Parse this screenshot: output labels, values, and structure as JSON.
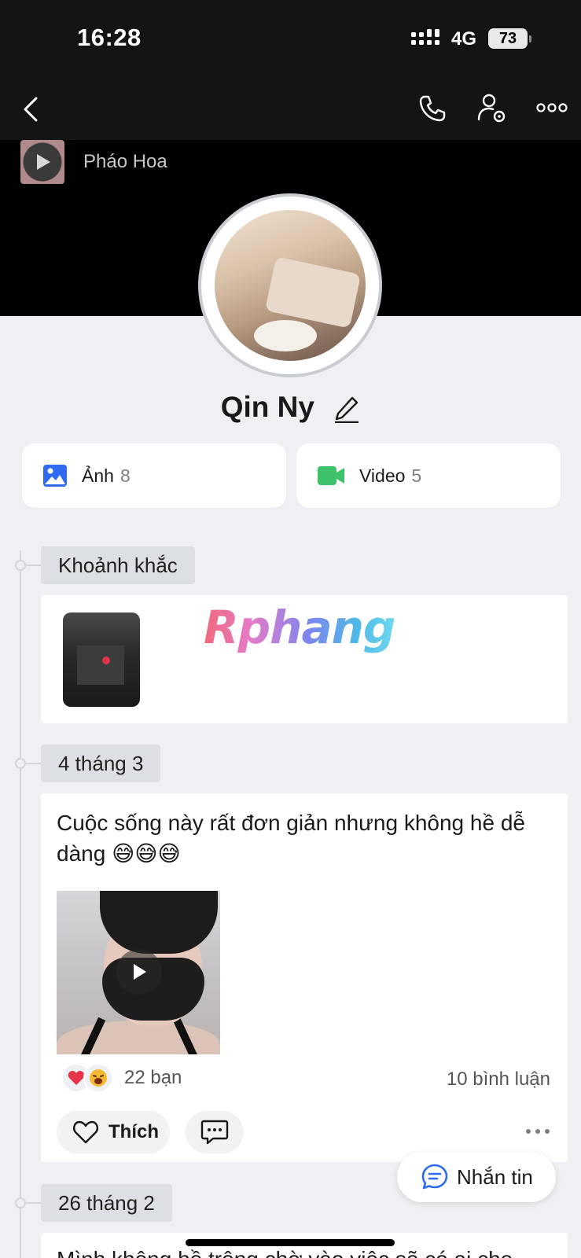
{
  "status_bar": {
    "time": "16:28",
    "network": "4G",
    "battery": "73"
  },
  "nav": {
    "back_icon": "chevron-left-icon",
    "call_icon": "phone-icon",
    "settings_icon": "user-gear-icon",
    "more_icon": "more-horizontal-icon"
  },
  "music": {
    "title": "Pháo Hoa"
  },
  "profile": {
    "name": "Qin Ny"
  },
  "media": {
    "photos_label": "Ảnh",
    "photos_count": "8",
    "videos_label": "Video",
    "videos_count": "5",
    "photo_color": "#2f6bf0",
    "video_color": "#3ec269"
  },
  "watermark": "Rphang",
  "timeline": [
    {
      "date": "Khoảnh khắc"
    },
    {
      "date": "4 tháng 3",
      "text": "Cuộc sống này rất đơn giản nhưng không hề dễ dàng 😅😅😅",
      "reactions": "22 bạn",
      "comments": "10 bình luận",
      "like_label": "Thích"
    },
    {
      "date": "26 tháng 2",
      "text": "Mình không hề trông chờ vào việc sẽ có ai cho"
    }
  ],
  "chat_button": {
    "label": "Nhắn tin"
  }
}
